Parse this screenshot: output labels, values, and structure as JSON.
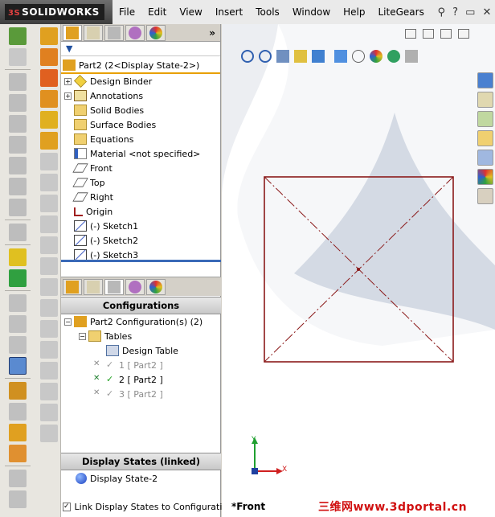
{
  "app": {
    "logo_text": "SOLIDWORKS",
    "logo_prefix": "3S"
  },
  "menu": [
    "File",
    "Edit",
    "View",
    "Insert",
    "Tools",
    "Window",
    "Help",
    "LiteGears"
  ],
  "feature_tree": {
    "filter_icon": "funnel-icon",
    "root": "Part2  (2<Display State-2>)",
    "items": [
      {
        "label": "Design Binder",
        "icon": "design-binder-icon",
        "expandable": true
      },
      {
        "label": "Annotations",
        "icon": "annotations-icon",
        "expandable": true
      },
      {
        "label": "Solid Bodies",
        "icon": "solid-bodies-folder-icon",
        "expandable": false
      },
      {
        "label": "Surface Bodies",
        "icon": "surface-bodies-folder-icon",
        "expandable": false
      },
      {
        "label": "Equations",
        "icon": "equations-folder-icon",
        "expandable": false
      },
      {
        "label": "Material <not specified>",
        "icon": "material-icon",
        "expandable": false
      },
      {
        "label": "Front",
        "icon": "plane-icon",
        "expandable": false
      },
      {
        "label": "Top",
        "icon": "plane-icon",
        "expandable": false
      },
      {
        "label": "Right",
        "icon": "plane-icon",
        "expandable": false
      },
      {
        "label": "Origin",
        "icon": "origin-icon",
        "expandable": false
      },
      {
        "label": "(-) Sketch1",
        "icon": "sketch-icon",
        "expandable": false
      },
      {
        "label": "(-) Sketch2",
        "icon": "sketch-icon",
        "expandable": false
      },
      {
        "label": "(-) Sketch3",
        "icon": "sketch-icon",
        "expandable": false
      }
    ]
  },
  "configurations": {
    "title": "Configurations",
    "root": "Part2 Configuration(s)  (2)",
    "tables": "Tables",
    "design_table": "Design Table",
    "configs": [
      {
        "label": "1 [ Part2 ]",
        "active": false
      },
      {
        "label": "2 [ Part2 ]",
        "active": true
      },
      {
        "label": "3 [ Part2 ]",
        "active": false
      }
    ]
  },
  "display_states": {
    "title": "Display States (linked)",
    "item": "Display State-2",
    "link_label": "Link Display States to Configurations",
    "link_checked": true,
    "link_mark": "✓"
  },
  "graphics": {
    "view_name": "*Front",
    "watermark": "三维网www.3dportal.cn",
    "axis_labels": {
      "x": "X",
      "y": "Y"
    },
    "sketch_color": "#8b1a1a"
  }
}
